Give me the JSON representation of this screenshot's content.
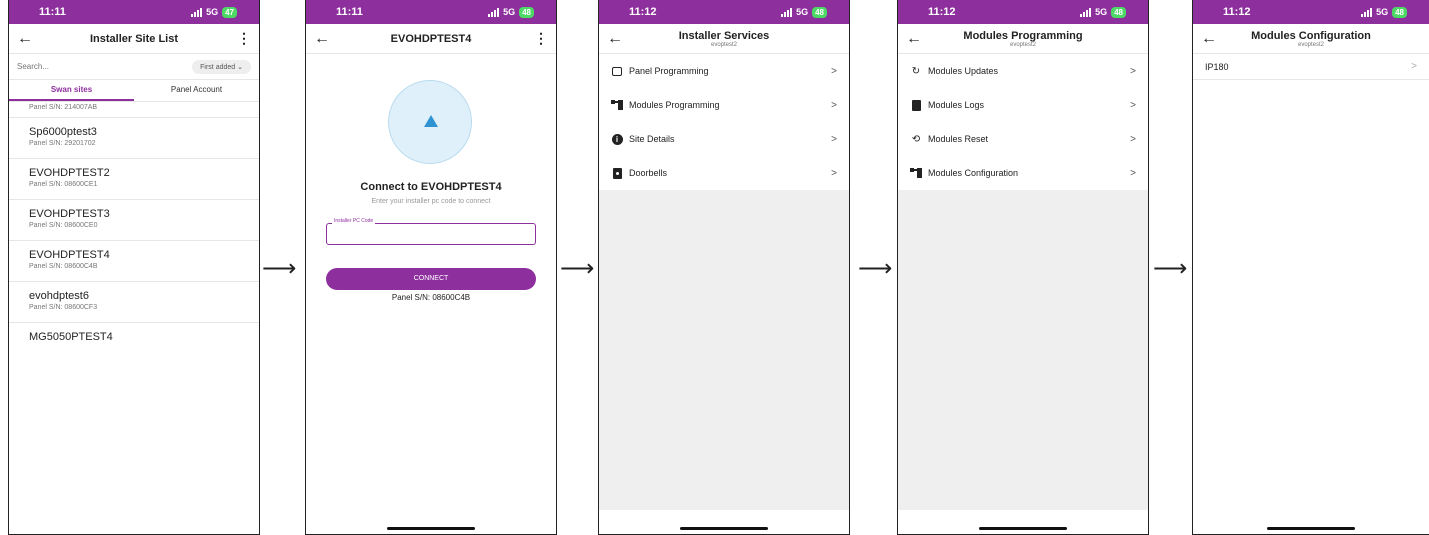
{
  "status": {
    "p1": {
      "time": "11:11",
      "net": "5G",
      "battery": "47"
    },
    "p2": {
      "time": "11:11",
      "net": "5G",
      "battery": "48"
    },
    "p3": {
      "time": "11:12",
      "net": "5G",
      "battery": "48"
    },
    "p4": {
      "time": "11:12",
      "net": "5G",
      "battery": "48"
    },
    "p5": {
      "time": "11:12",
      "net": "5G",
      "battery": "48"
    }
  },
  "site_list": {
    "title": "Installer Site List",
    "search_placeholder": "Search...",
    "sort_label": "First added",
    "tabs": [
      "Swan sites",
      "Panel Account"
    ],
    "first_partial_sn": "Panel S/N: 214007AB",
    "sites": [
      {
        "name": "Sp6000ptest3",
        "sn": "Panel S/N: 29201702"
      },
      {
        "name": "EVOHDPTEST2",
        "sn": "Panel S/N: 08600CE1"
      },
      {
        "name": "EVOHDPTEST3",
        "sn": "Panel S/N: 08600CE0"
      },
      {
        "name": "EVOHDPTEST4",
        "sn": "Panel S/N: 08600C4B"
      },
      {
        "name": "evohdptest6",
        "sn": "Panel S/N: 08600CF3"
      },
      {
        "name": "MG5050PTEST4",
        "sn": ""
      }
    ]
  },
  "connect": {
    "title": "EVOHDPTEST4",
    "heading": "Connect to EVOHDPTEST4",
    "subheading": "Enter your installer pc code to connect",
    "field_label": "Installer PC Code",
    "button": "CONNECT",
    "panel_sn": "Panel S/N: 08600C4B"
  },
  "installer_services": {
    "title": "Installer Services",
    "subtitle": "evoptest2",
    "items": [
      "Panel Programming",
      "Modules Programming",
      "Site Details",
      "Doorbells"
    ]
  },
  "modules_programming": {
    "title": "Modules Programming",
    "subtitle": "evoptest2",
    "items": [
      "Modules Updates",
      "Modules Logs",
      "Modules Reset",
      "Modules Configuration"
    ]
  },
  "modules_configuration": {
    "title": "Modules Configuration",
    "subtitle": "evoptest2",
    "items": [
      "IP180"
    ]
  },
  "icons": {
    "back": "arrow-left-icon",
    "menu": "kebab-menu-icon",
    "chevron": "chevron-right-icon",
    "flow_arrow": "long-arrow-right-icon"
  },
  "colors": {
    "accent": "#8e2f9e",
    "battery": "#4cd964",
    "connect_circle": "#e0f0fa",
    "triangle": "#2f93d1"
  }
}
